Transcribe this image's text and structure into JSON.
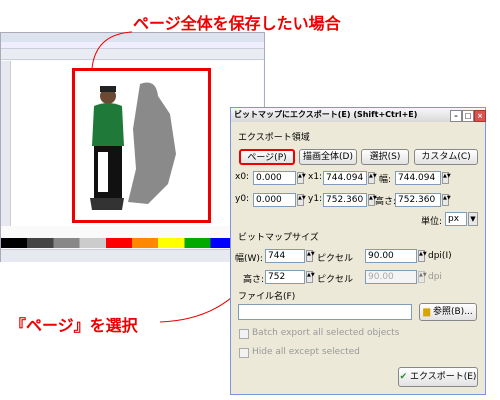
{
  "callouts": {
    "top": "ページ全体を保存したい場合",
    "bottom": "『ページ』を選択"
  },
  "colors": {
    "accent": "#e00000",
    "dialog_bg": "#ece9d8"
  },
  "dialog": {
    "title": "ビットマップにエクスポート(E) (Shift+Ctrl+E)",
    "title_buttons": [
      "minimize-icon",
      "restore-icon",
      "close-icon"
    ],
    "export_area_heading": "エクスポート領域",
    "area_buttons": [
      "ページ(P)",
      "描画全体(D)",
      "選択(S)",
      "カスタム(C)"
    ],
    "coords": {
      "x0_label": "x0:",
      "x0": "0.000",
      "x1_label": "x1:",
      "x1": "744.094",
      "width_label": "幅:",
      "width": "744.094",
      "y0_label": "y0:",
      "y0": "0.000",
      "y1_label": "y1:",
      "y1": "752.360",
      "height_label": "高さ:",
      "height": "752.360"
    },
    "unit_label": "単位:",
    "unit_value": "px",
    "bitmap_size_heading": "ビットマップサイズ",
    "bitmap": {
      "width_label": "幅(W):",
      "width": "744",
      "width_unit": "ピクセル",
      "width_dpi": "90.00",
      "width_dpi_label": "dpi(I)",
      "height_label": "高さ:",
      "height": "752",
      "height_unit": "ピクセル",
      "height_dpi": "90.00",
      "height_dpi_label": "dpi"
    },
    "filename_label": "ファイル名(F)",
    "filename_value": "",
    "browse_button": "参照(B)...",
    "batch_export": "Batch export all selected objects",
    "hide_except": "Hide all except selected",
    "export_button": "エクスポート(E)"
  }
}
